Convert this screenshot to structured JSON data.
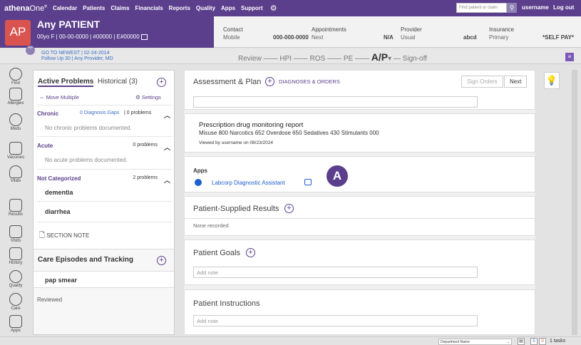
{
  "topnav": {
    "logo_bold": "athena",
    "logo_light": "One",
    "logo_mark": "®",
    "items": [
      "Calendar",
      "Patients",
      "Claims",
      "Financials",
      "Reports",
      "Quality",
      "Apps",
      "Support"
    ],
    "find_placeholder": "Find patient or claim",
    "username": "username",
    "logout": "Log out"
  },
  "patient": {
    "avatar": "AP",
    "name": "Any  PATIENT",
    "info": "00yo F  |  00-00-0000  |  #00000  |  E#00000"
  },
  "banner": {
    "contact_h": "Contact",
    "contact_type": "Mobile",
    "contact_val": "000-000-0000",
    "appt_h": "Appointments",
    "appt_type": "Next",
    "appt_val": "N/A",
    "provider_h": "Provider",
    "provider_type": "Usual",
    "provider_val": "abcd",
    "insurance_h": "Insurance",
    "insurance_type": "Primary",
    "insurance_val": "*SELF PAY*"
  },
  "sub": {
    "line1": "GO TO NEWEST | 02-24-2014",
    "line2": "Follow Up 30 | Any Provider, MD"
  },
  "steps": {
    "review": "Review",
    "hpi": "HPI",
    "ros": "ROS",
    "pe": "PE",
    "ap": "A/P",
    "signoff": "Sign-off"
  },
  "leftbar": [
    "Find",
    "Allergies",
    "Meds",
    "Vaccines",
    "Vitals",
    "Results",
    "Visits",
    "History",
    "Quality",
    "Care",
    "Apps"
  ],
  "problems": {
    "tab_active": "Active Problems",
    "tab_hist": "Historical (3)",
    "move": "Move Multiple",
    "settings": "Settings",
    "chronic": "Chronic",
    "chronic_gaps": "0 Diagnosis Gaps",
    "chronic_cnt": "| 0 problems",
    "chronic_none": "No chronic problems documented.",
    "acute": "Acute",
    "acute_cnt": "0 problems",
    "acute_none": "No acute problems documented.",
    "notcat": "Not Categorized",
    "notcat_cnt": "2 problems",
    "item1": "dementia",
    "item2": "diarrhea",
    "section_note": "SECTION NOTE",
    "care_title": "Care Episodes and Tracking",
    "care_item": "pap smear",
    "reviewed": "Reviewed"
  },
  "main": {
    "ap_title": "Assessment & Plan",
    "dx_orders": "DIAGNOSES & ORDERS",
    "sign_orders": "Sign Orders",
    "next": "Next",
    "pdmp_title": "Prescription drug monitoring report",
    "pdmp_vals": "Misuse 800   Narcotics 652   Overdose 650   Sedatives 430   Stimulants 000",
    "pdmp_viewed": "Viewed by username on 08/23/2024",
    "apps_h": "Apps",
    "app_name": "Labcorp Diagnostic Assistant",
    "psr_title": "Patient-Supplied Results",
    "psr_none": "None recorded",
    "goals_title": "Patient Goals",
    "goals_ph": "Add note",
    "instr_title": "Patient Instructions",
    "instr_ph": "Add note",
    "marker": "A"
  },
  "bottom": {
    "dept": "Department Name",
    "count1": "0",
    "count2": "0",
    "tasks": "1 tasks"
  }
}
